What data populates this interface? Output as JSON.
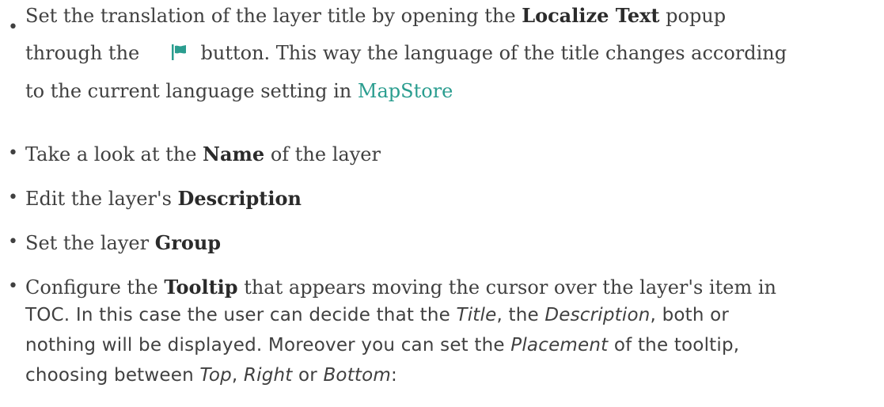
{
  "items": [
    {
      "bullet": "•",
      "l1_a": "Set the translation of the layer title by opening the ",
      "l1_b": "Localize Text",
      "l1_c": " popup",
      "l2_a": "through the ",
      "flag_icon": "flag-icon",
      "l2_b": " button. This way the language of the title changes according",
      "l3_a": "to the current language setting in ",
      "l3_link": "MapStore"
    },
    {
      "bullet": "•",
      "a": "Take a look at the ",
      "b": "Name",
      "c": " of the layer"
    },
    {
      "bullet": "•",
      "a": "Edit the layer's ",
      "b": "Description"
    },
    {
      "bullet": "•",
      "a": "Set the layer ",
      "b": "Group"
    },
    {
      "bullet": "•",
      "l1_a": "Configure the ",
      "l1_b": "Tooltip",
      "l1_c": " that appears moving the cursor over the layer's item in",
      "l2_a": "TOC. In this case the user can decide that the ",
      "l2_i1": "Title",
      "l2_b": ", the ",
      "l2_i2": "Description",
      "l2_c": ", both or",
      "l3_a": "nothing will be displayed. Moreover you can set the ",
      "l3_i": "Placement",
      "l3_b": " of the tooltip,",
      "l4_a": "choosing between ",
      "l4_i1": "Top",
      "l4_b": ", ",
      "l4_i2": "Right",
      "l4_c": " or ",
      "l4_i3": "Bottom",
      "l4_d": ":"
    }
  ],
  "colors": {
    "link": "#2a9d8f",
    "flag": "#2a9d8f",
    "text": "#404040"
  }
}
